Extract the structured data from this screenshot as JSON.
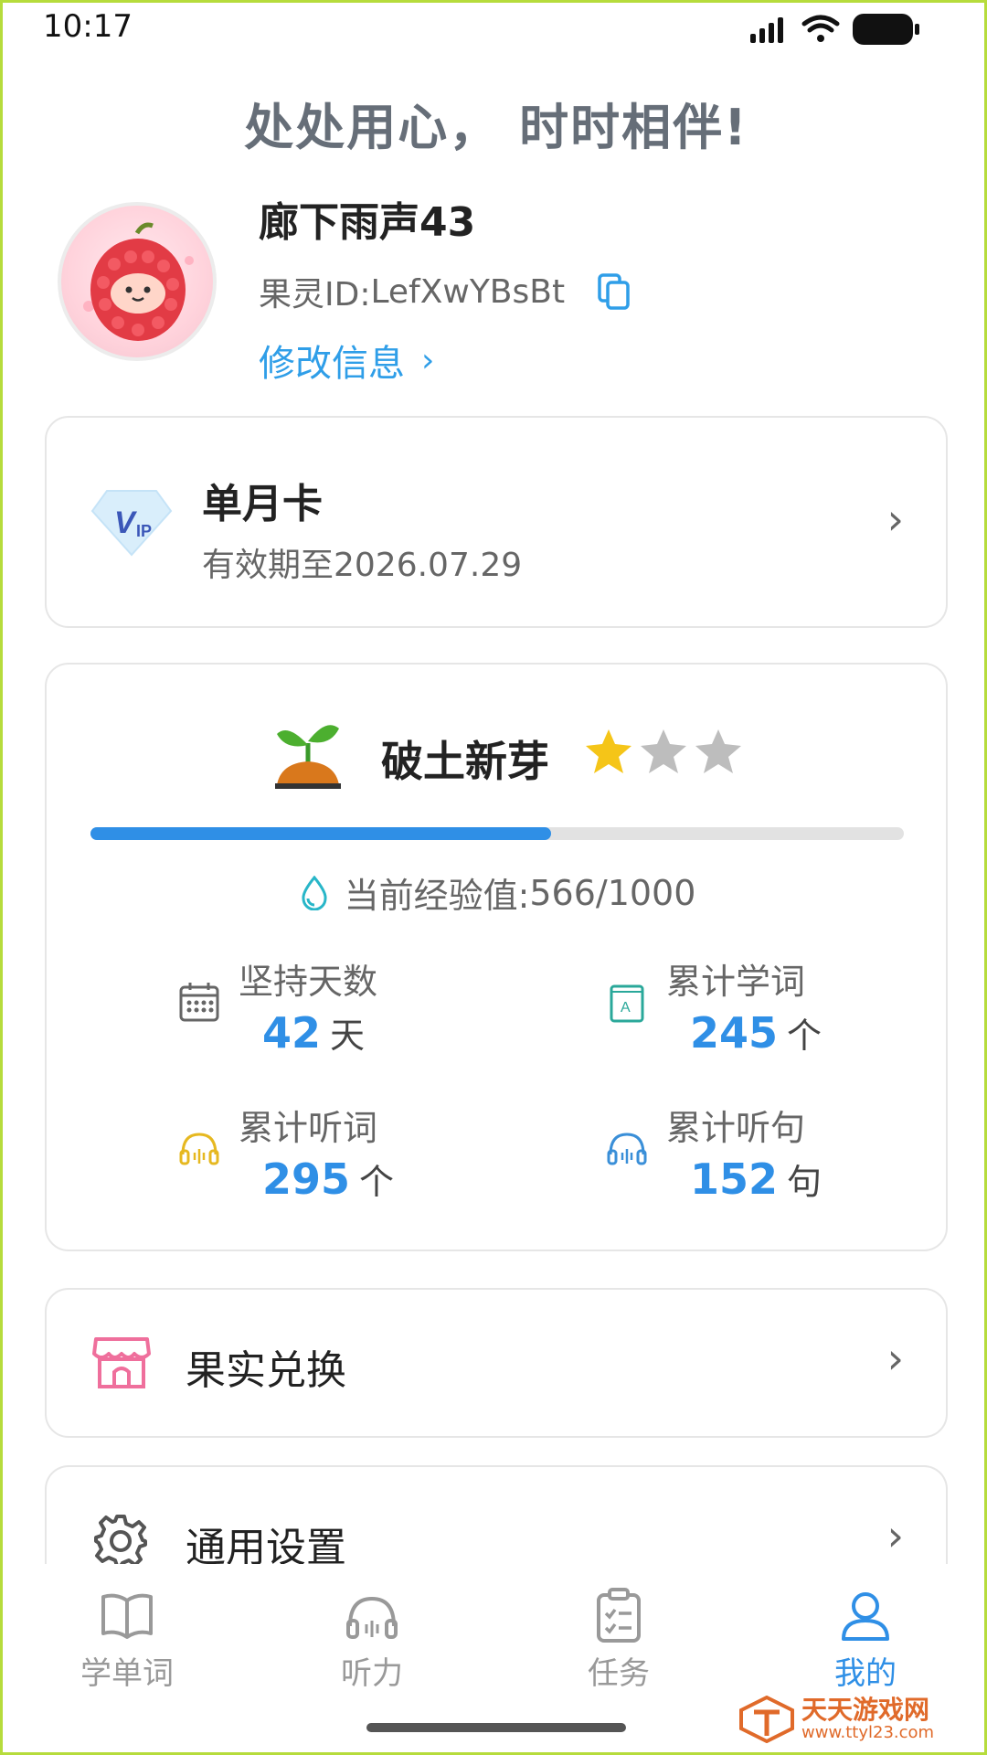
{
  "status_bar": {
    "time": "10:17"
  },
  "slogan": "处处用心， 时时相伴!",
  "profile": {
    "username": "廊下雨声43",
    "id_label": "果灵ID: ",
    "id_value": "LefXwYBsBt",
    "edit_label": "修改信息"
  },
  "vip": {
    "name": "单月卡",
    "expiry": "有效期至2026.07.29"
  },
  "level": {
    "name": "破土新芽",
    "stars_filled": 1,
    "stars_total": 3,
    "exp_label": "当前经验值: ",
    "exp_value": "566/1000",
    "progress_fraction": 0.566
  },
  "stats": {
    "days": {
      "label": "坚持天数",
      "value": "42",
      "unit": "天"
    },
    "words": {
      "label": "累计学词",
      "value": "245",
      "unit": "个"
    },
    "listen_words": {
      "label": "累计听词",
      "value": "295",
      "unit": "个"
    },
    "listen_sentences": {
      "label": "累计听句",
      "value": "152",
      "unit": "句"
    }
  },
  "menu": {
    "exchange": "果实兑换",
    "settings": "通用设置"
  },
  "nav": [
    {
      "label": "学单词",
      "icon": "book-icon"
    },
    {
      "label": "听力",
      "icon": "headphones-icon"
    },
    {
      "label": "任务",
      "icon": "clipboard-icon"
    },
    {
      "label": "我的",
      "icon": "person-icon"
    }
  ],
  "colors": {
    "accent": "#2f8fe6",
    "star": "#f5c518",
    "border": "#b6dc3c"
  },
  "watermark": {
    "text": "天天游戏网",
    "url": "www.ttyl23.com"
  }
}
